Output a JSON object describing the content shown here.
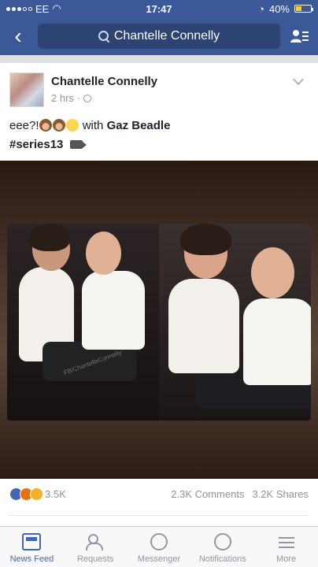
{
  "status_bar": {
    "carrier": "EE",
    "time": "17:47",
    "battery": "40%"
  },
  "nav": {
    "search_text": "Chantelle Connelly"
  },
  "post": {
    "author": "Chantelle Connelly",
    "time_ago": "2 hrs",
    "separator": "·",
    "text_prefix": "eee?!",
    "text_with": "with",
    "tagged": "Gaz Beadle",
    "hashtag": "#series13"
  },
  "engagement": {
    "reactions_count": "3.5K",
    "comments": "2.3K Comments",
    "shares": "3.2K Shares"
  },
  "tabs": [
    {
      "label": "News Feed",
      "icon": "news-feed-icon",
      "active": true
    },
    {
      "label": "Requests",
      "icon": "requests-icon",
      "active": false
    },
    {
      "label": "Messenger",
      "icon": "messenger-icon",
      "active": false
    },
    {
      "label": "Notifications",
      "icon": "notifications-icon",
      "active": false
    },
    {
      "label": "More",
      "icon": "more-icon",
      "active": false
    }
  ],
  "colors": {
    "brand": "#3b5998",
    "active_tab": "#4267b2",
    "muted": "#90949c"
  }
}
